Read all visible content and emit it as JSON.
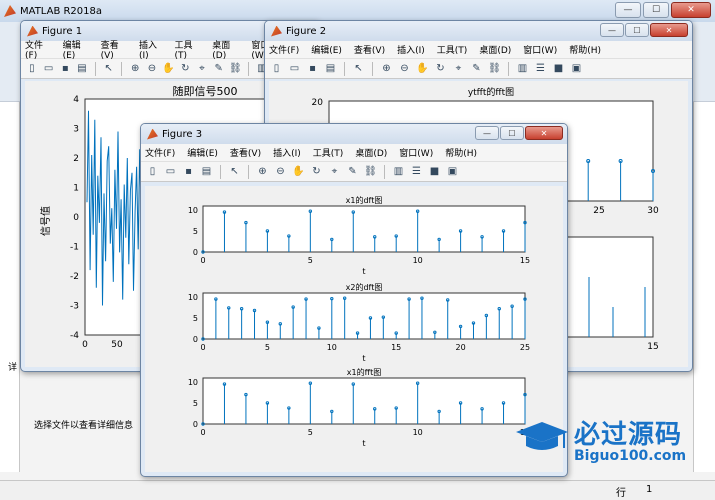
{
  "matlab": {
    "title": "MATLAB R2018a",
    "detail_label": "详",
    "detail_text": "选择文件以查看详细信息",
    "status_row": "行",
    "status_col": "1"
  },
  "menu": [
    "文件(F)",
    "编辑(E)",
    "查看(V)",
    "插入(I)",
    "工具(T)",
    "桌面(D)",
    "窗口(W)",
    "帮助(H)"
  ],
  "toolbar_icons": [
    "new-figure-icon",
    "open-file-icon",
    "save-icon",
    "print-icon",
    "select-arrow-icon",
    "zoom-in-icon",
    "zoom-out-icon",
    "pan-icon",
    "rotate-icon",
    "data-cursor-icon",
    "brush-icon",
    "link-icon",
    "colorbar-icon",
    "legend-icon",
    "hide-plot-tools-icon",
    "show-plot-tools-icon"
  ],
  "figure1": {
    "title": "Figure 1",
    "axes_title": "随即信号500",
    "ylabel": "信号值",
    "yticks": [
      "4",
      "3",
      "2",
      "1",
      "0",
      "-1",
      "-2",
      "-3",
      "-4"
    ],
    "xticks": [
      "0",
      "50"
    ]
  },
  "figure2": {
    "title": "Figure 2",
    "axes_title": "ytfft的fft图",
    "top_yticks": [
      "20"
    ],
    "top_xticks": [
      "25",
      "30"
    ],
    "bottom_xticks": [
      "15"
    ]
  },
  "figure3": {
    "title": "Figure 3",
    "plots": [
      {
        "title": "x1的dft图",
        "xlabel": "t",
        "yticks": [
          "10",
          "5",
          "0"
        ],
        "xticks": [
          "0",
          "5",
          "10",
          "15"
        ],
        "xmax": 15
      },
      {
        "title": "x2的dft图",
        "xlabel": "t",
        "yticks": [
          "10",
          "5",
          "0"
        ],
        "xticks": [
          "0",
          "5",
          "10",
          "15",
          "20",
          "25"
        ],
        "xmax": 25
      },
      {
        "title": "x1的fft图",
        "xlabel": "t",
        "yticks": [
          "10",
          "5",
          "0"
        ],
        "xticks": [
          "0",
          "5",
          "10",
          "15"
        ],
        "xmax": 15
      }
    ]
  },
  "watermark": {
    "main": "必过源码",
    "sub": "Biguo100.com"
  },
  "chart_data": [
    {
      "type": "line",
      "title": "随即信号500",
      "ylabel": "信号值",
      "ylim": [
        -4,
        4
      ],
      "xlim": [
        0,
        500
      ],
      "series": [
        {
          "values": [
            0.5,
            3.6,
            -1.8,
            2.1,
            -0.6,
            3.3,
            -2.4,
            1.4,
            -0.2,
            2.7,
            -3.0,
            0.8,
            -1.5,
            1.9,
            2.4,
            -0.9,
            0.3,
            -2.2,
            1.6,
            -0.4,
            2.9,
            -1.2,
            0.6,
            -2.8,
            1.1,
            -0.7,
            2.0,
            -1.6,
            0.9,
            1.5,
            -2.5,
            0.2,
            1.7,
            -1.1,
            2.3,
            -0.3,
            -1.9,
            1.2,
            0.1,
            -1.0
          ]
        }
      ]
    },
    {
      "type": "bar",
      "title": "x1的dft图",
      "xlabel": "t",
      "ylim": [
        0,
        10
      ],
      "x": [
        0,
        1,
        2,
        3,
        4,
        5,
        6,
        7,
        8,
        9,
        10,
        11,
        12,
        13,
        14,
        15
      ],
      "values": [
        0,
        9.5,
        7,
        5,
        3.8,
        9.7,
        3,
        9.5,
        3.6,
        3.8,
        9.7,
        3,
        5,
        3.6,
        5,
        7
      ]
    },
    {
      "type": "bar",
      "title": "x2的dft图",
      "xlabel": "t",
      "ylim": [
        0,
        10
      ],
      "x": [
        0,
        1,
        2,
        3,
        4,
        5,
        6,
        7,
        8,
        9,
        10,
        11,
        12,
        13,
        14,
        15,
        16,
        17,
        18,
        19,
        20,
        21,
        22,
        23,
        24,
        25
      ],
      "values": [
        0,
        9.5,
        7.4,
        7.2,
        6.8,
        4,
        3.6,
        7.6,
        9.5,
        2.6,
        9.6,
        9.7,
        1.4,
        5,
        5.2,
        1.4,
        9.5,
        9.7,
        1.6,
        9.3,
        3,
        3.8,
        5.6,
        7.2,
        7.8,
        9.5
      ]
    },
    {
      "type": "bar",
      "title": "x1的fft图",
      "xlabel": "t",
      "ylim": [
        0,
        10
      ],
      "x": [
        0,
        1,
        2,
        3,
        4,
        5,
        6,
        7,
        8,
        9,
        10,
        11,
        12,
        13,
        14,
        15
      ],
      "values": [
        0,
        9.5,
        7,
        5,
        3.8,
        9.7,
        3,
        9.5,
        3.6,
        3.8,
        9.7,
        3,
        5,
        3.6,
        5,
        7
      ]
    },
    {
      "type": "bar",
      "title": "ytfft的fft图",
      "xlim": [
        20,
        30
      ],
      "ylim": [
        0,
        20
      ],
      "x": [
        22,
        23,
        24,
        25,
        26,
        27,
        28,
        29,
        30
      ],
      "values": [
        4,
        6,
        3,
        9,
        7,
        3,
        8,
        8,
        6
      ]
    }
  ]
}
